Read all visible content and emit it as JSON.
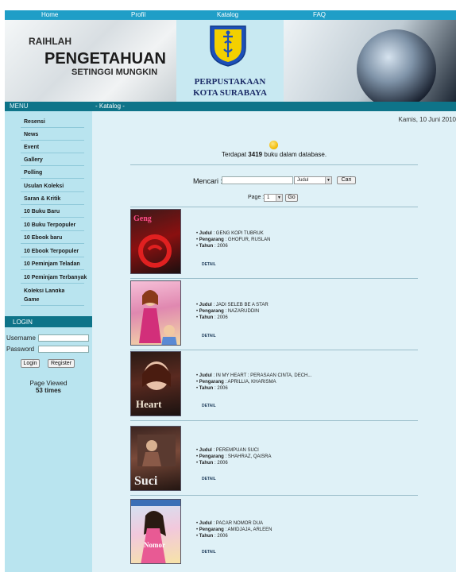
{
  "nav": [
    "Home",
    "Profil",
    "Katalog",
    "FAQ"
  ],
  "banner": {
    "line1": "RAIHLAH",
    "line2": "PENGETAHUAN",
    "line3": "SETINGGI MUNGKIN",
    "library_line1": "PERPUSTAKAAN",
    "library_line2": "KOTA SURABAYA"
  },
  "menubar": {
    "title": "MENU",
    "breadcrumb": "- Katalog -"
  },
  "sidebar": {
    "items": [
      "Resensi",
      "News",
      "Event",
      "Gallery",
      "Polling",
      "Usulan Koleksi",
      "Saran & Kritik",
      "10 Buku Baru",
      "10 Buku Terpopuler",
      "10 Ebook baru",
      "10 Ebook Terpopuler",
      "10 Peminjam Teladan",
      "10 Peminjam Terbanyak",
      "Koleksi Langka",
      "Game"
    ],
    "login_title": "LOGIN",
    "username_label": "Username",
    "password_label": "Password",
    "login_button": "Login",
    "register_button": "Register",
    "page_viewed_label": "Page Viewed",
    "page_viewed_count": "53 times"
  },
  "main": {
    "date": "Kamis, 10 Juni 2010",
    "count_prefix": "Terdapat ",
    "count_value": "3419",
    "count_suffix": " buku dalam database.",
    "search_label": "Mencari :",
    "search_value": "",
    "search_field_selected": "Judul",
    "search_button": "Cari",
    "page_label": "Page :",
    "page_selected": "1",
    "go_button": "Go",
    "judul_label": "Judul",
    "pengarang_label": "Pengarang",
    "tahun_label": "Tahun",
    "detail_label": "DETAIL"
  },
  "books": [
    {
      "judul": "GENG KOPI TUBRUK",
      "pengarang": "GHOFUR, RUSLAN",
      "tahun": "2006",
      "cover_text": "Geng"
    },
    {
      "judul": "JADI SELEB BE A STAR",
      "pengarang": "NAZARUDDIN",
      "tahun": "2006",
      "cover_text": ""
    },
    {
      "judul": "IN MY HEART : PERASAAN CINTA, DECH...",
      "pengarang": "APRILLIA, KHARISMA",
      "tahun": "2006",
      "cover_text": "Heart"
    },
    {
      "judul": "PEREMPUAN SUCI",
      "pengarang": "SHAHRAZ, QAISRA",
      "tahun": "2006",
      "cover_text": "Suci"
    },
    {
      "judul": "PACAR NOMOR DUA",
      "pengarang": "AMIDJAJA, ARLEEN",
      "tahun": "2006",
      "cover_text": "Nomor"
    }
  ],
  "colors": {
    "nav_bg": "#1f9ec7",
    "menubar_bg": "#0e7489",
    "sidebar_bg": "#b9e4ef",
    "main_bg": "#dff1f7"
  }
}
